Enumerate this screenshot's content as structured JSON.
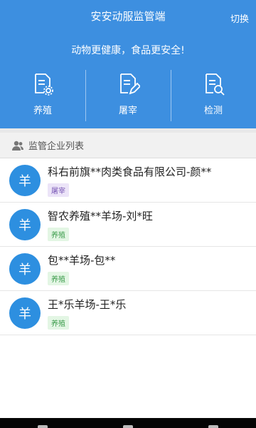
{
  "header": {
    "title": "安安动服监管端",
    "switch_label": "切换"
  },
  "banner": {
    "slogan": "动物更健康，食品更安全!"
  },
  "modules": [
    {
      "label": "养殖",
      "icon": "doc-gear-icon"
    },
    {
      "label": "屠宰",
      "icon": "doc-edit-icon"
    },
    {
      "label": "检测",
      "icon": "doc-search-icon"
    }
  ],
  "section": {
    "title": "监管企业列表",
    "icon": "users-icon"
  },
  "companies": [
    {
      "avatar": "羊",
      "name": "科右前旗**肉类食品有限公司-颜**",
      "tag": "屠宰",
      "tag_color": "purple"
    },
    {
      "avatar": "羊",
      "name": "智农养殖**羊场-刘*旺",
      "tag": "养殖",
      "tag_color": "green"
    },
    {
      "avatar": "羊",
      "name": "包**羊场-包**",
      "tag": "养殖",
      "tag_color": "green"
    },
    {
      "avatar": "羊",
      "name": "王*乐羊场-王*乐",
      "tag": "养殖",
      "tag_color": "green"
    }
  ],
  "colors": {
    "primary": "#3d8fe0",
    "avatar": "#2d8fe0",
    "tag_purple": "#7a58b6",
    "tag_green": "#3a9b4a"
  }
}
